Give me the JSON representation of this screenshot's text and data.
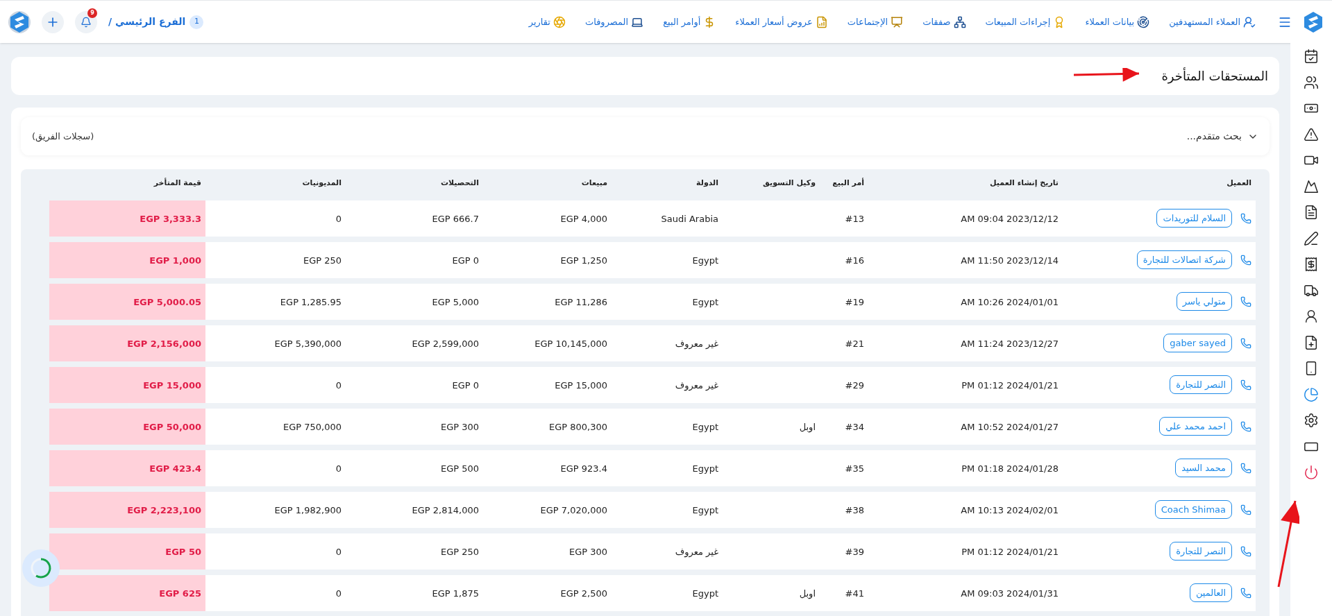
{
  "topbar": {
    "nav": [
      {
        "label": "العملاء المستهدفين"
      },
      {
        "label": "بيانات العملاء"
      },
      {
        "label": "إجراءات المبيعات"
      },
      {
        "label": "صفقات"
      },
      {
        "label": "الإجتماعات"
      },
      {
        "label": "عروض أسعار العملاء"
      },
      {
        "label": "أوامر البيع"
      },
      {
        "label": "المصروفات"
      },
      {
        "label": "تقارير"
      }
    ],
    "branch_number": "1",
    "branch": "الفرع الرئيسي /",
    "notifications": "9"
  },
  "page_title": "المستحقات المتأخرة",
  "search": {
    "label": "بحث متقدم...",
    "scope": "(سجلات الفريق)"
  },
  "table": {
    "columns": [
      "العميل",
      "تاريخ إنشاء العميل",
      "أمر البيع",
      "وكيل التسويق",
      "الدولة",
      "مبيعات",
      "التحصيلات",
      "المديونيات",
      "قيمة المتأخر"
    ],
    "rows": [
      [
        "السلام للتوريدات",
        "AM 09:04 2023/12/12",
        "#13",
        "",
        "Saudi Arabia",
        "EGP 4,000",
        "EGP 666.7",
        "0",
        "EGP 3,333.3"
      ],
      [
        "شركة اتصالات للتجارة",
        "AM 11:50 2023/12/14",
        "#16",
        "",
        "Egypt",
        "EGP 1,250",
        "EGP 0",
        "EGP 250",
        "EGP 1,000"
      ],
      [
        "متولي ياسر",
        "AM 10:26 2024/01/01",
        "#19",
        "",
        "Egypt",
        "EGP 11,286",
        "EGP 5,000",
        "EGP 1,285.95",
        "EGP 5,000.05"
      ],
      [
        "gaber sayed",
        "AM 11:24 2023/12/27",
        "#21",
        "",
        "غير معروف",
        "EGP 10,145,000",
        "EGP 2,599,000",
        "EGP 5,390,000",
        "EGP 2,156,000"
      ],
      [
        "النصر للتجارة",
        "PM 01:12 2024/01/21",
        "#29",
        "",
        "غير معروف",
        "EGP 15,000",
        "EGP 0",
        "0",
        "EGP 15,000"
      ],
      [
        "احمد محمد علي",
        "AM 10:52 2024/01/27",
        "#34",
        "اوبل",
        "Egypt",
        "EGP 800,300",
        "EGP 300",
        "EGP 750,000",
        "EGP 50,000"
      ],
      [
        "محمد السيد",
        "PM 01:18 2024/01/28",
        "#35",
        "",
        "Egypt",
        "EGP 923.4",
        "EGP 500",
        "0",
        "EGP 423.4"
      ],
      [
        "Coach Shimaa",
        "AM 10:13 2024/02/01",
        "#38",
        "",
        "Egypt",
        "EGP 7,020,000",
        "EGP 2,814,000",
        "EGP 1,982,900",
        "EGP 2,223,100"
      ],
      [
        "النصر للتجارة",
        "PM 01:12 2024/01/21",
        "#39",
        "",
        "غير معروف",
        "EGP 300",
        "EGP 250",
        "0",
        "EGP 50"
      ],
      [
        "العالمين",
        "AM 09:03 2024/01/31",
        "#41",
        "اوبل",
        "Egypt",
        "EGP 2,500",
        "EGP 1,875",
        "0",
        "EGP 625"
      ]
    ]
  },
  "sidebar": {
    "items": [
      {
        "kind": "calendar",
        "selected": false
      },
      {
        "kind": "group",
        "selected": false
      },
      {
        "kind": "cash",
        "selected": false
      },
      {
        "kind": "warning",
        "selected": false
      },
      {
        "kind": "video",
        "selected": false
      },
      {
        "kind": "mountain",
        "selected": false
      },
      {
        "kind": "invoice",
        "selected": false
      },
      {
        "kind": "signature",
        "selected": false
      },
      {
        "kind": "receipt",
        "selected": false
      },
      {
        "kind": "truck",
        "selected": false
      },
      {
        "kind": "contact",
        "selected": false
      },
      {
        "kind": "add-file",
        "selected": false
      },
      {
        "kind": "phone",
        "selected": false
      },
      {
        "kind": "chart",
        "selected": true
      },
      {
        "kind": "settings",
        "selected": false
      },
      {
        "kind": "screen",
        "selected": false
      },
      {
        "kind": "power",
        "selected": false
      }
    ]
  }
}
